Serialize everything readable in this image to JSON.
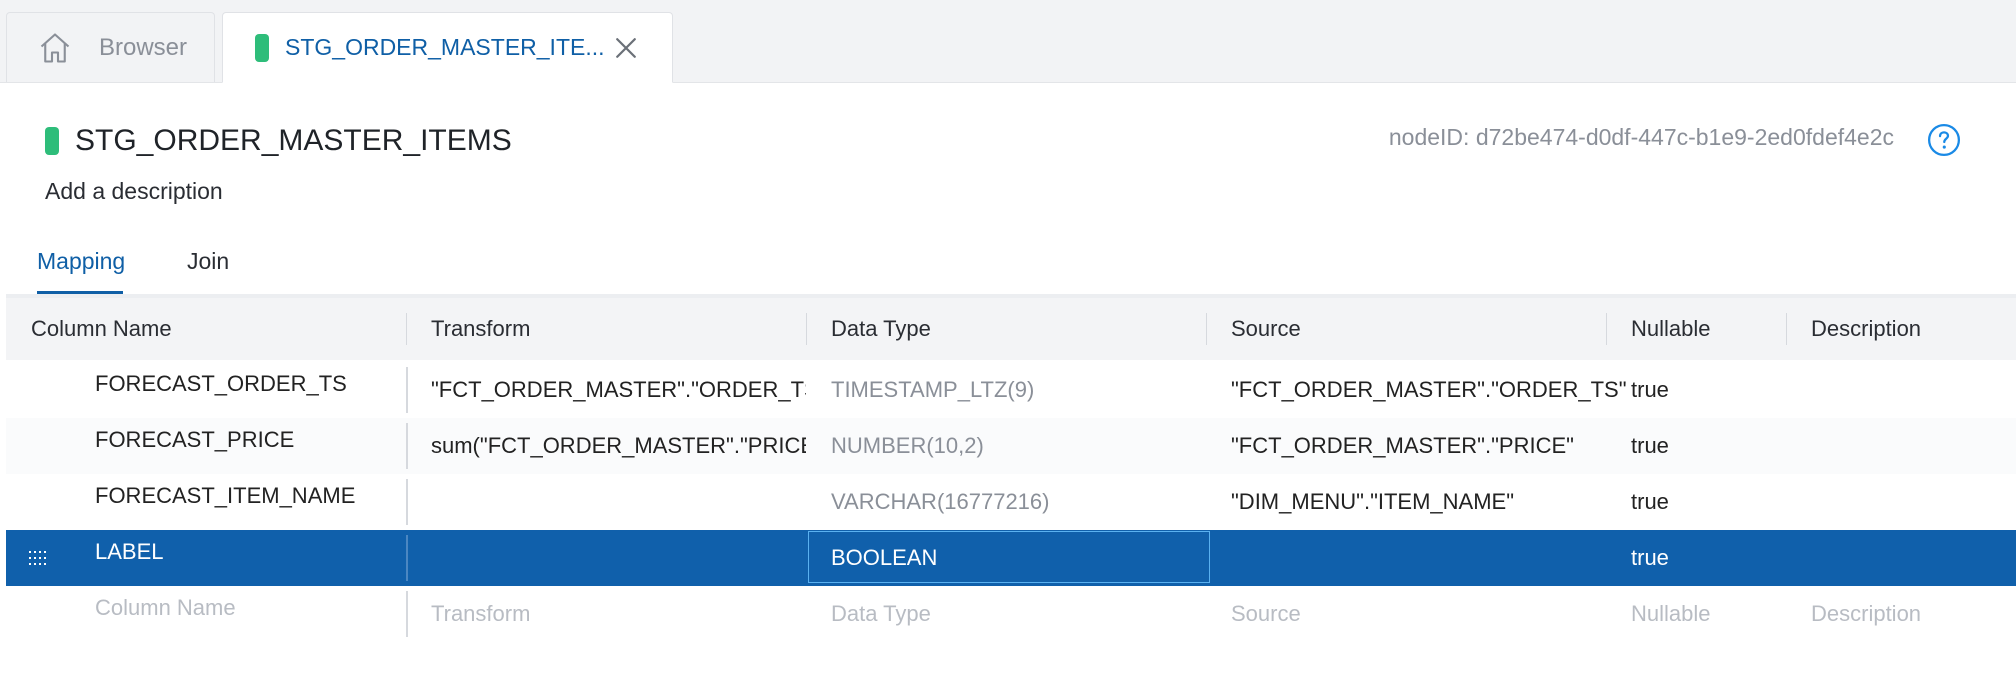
{
  "tabs": [
    {
      "label": "Browser"
    },
    {
      "label": "STG_ORDER_MASTER_ITE..."
    }
  ],
  "node": {
    "title": "STG_ORDER_MASTER_ITEMS",
    "description_placeholder": "Add a description",
    "node_id_text": "nodeID: d72be474-d0df-447c-b1e9-2ed0fdef4e2c"
  },
  "mapping_tabs": [
    {
      "label": "Mapping",
      "active": true
    },
    {
      "label": "Join",
      "active": false
    }
  ],
  "columns": [
    "Column Name",
    "Transform",
    "Data Type",
    "Source",
    "Nullable",
    "Description"
  ],
  "rows": [
    {
      "column_name": "FORECAST_ORDER_TS",
      "transform": "\"FCT_ORDER_MASTER\".\"ORDER_TS\"::d",
      "data_type": "TIMESTAMP_LTZ(9)",
      "source": "\"FCT_ORDER_MASTER\".\"ORDER_TS\"",
      "nullable": "true",
      "description": ""
    },
    {
      "column_name": "FORECAST_PRICE",
      "transform": "sum(\"FCT_ORDER_MASTER\".\"PRICE\")",
      "data_type": "NUMBER(10,2)",
      "source": "\"FCT_ORDER_MASTER\".\"PRICE\"",
      "nullable": "true",
      "description": ""
    },
    {
      "column_name": "FORECAST_ITEM_NAME",
      "transform": "",
      "data_type": "VARCHAR(16777216)",
      "source": "\"DIM_MENU\".\"ITEM_NAME\"",
      "nullable": "true",
      "description": ""
    },
    {
      "column_name": "LABEL",
      "transform": "",
      "data_type": "BOOLEAN",
      "source": "",
      "nullable": "true",
      "description": "",
      "selected": true
    }
  ],
  "new_row_placeholders": {
    "column_name": "Column Name",
    "transform": "Transform",
    "data_type": "Data Type",
    "source": "Source",
    "nullable": "Nullable",
    "description": "Description"
  },
  "colors": {
    "accent": "#0f5fa6",
    "selected_row": "#1060ab",
    "node_badge": "#2ebd7a"
  },
  "icons": [
    "home-icon",
    "close-icon",
    "help-icon",
    "drag-handle-icon"
  ]
}
